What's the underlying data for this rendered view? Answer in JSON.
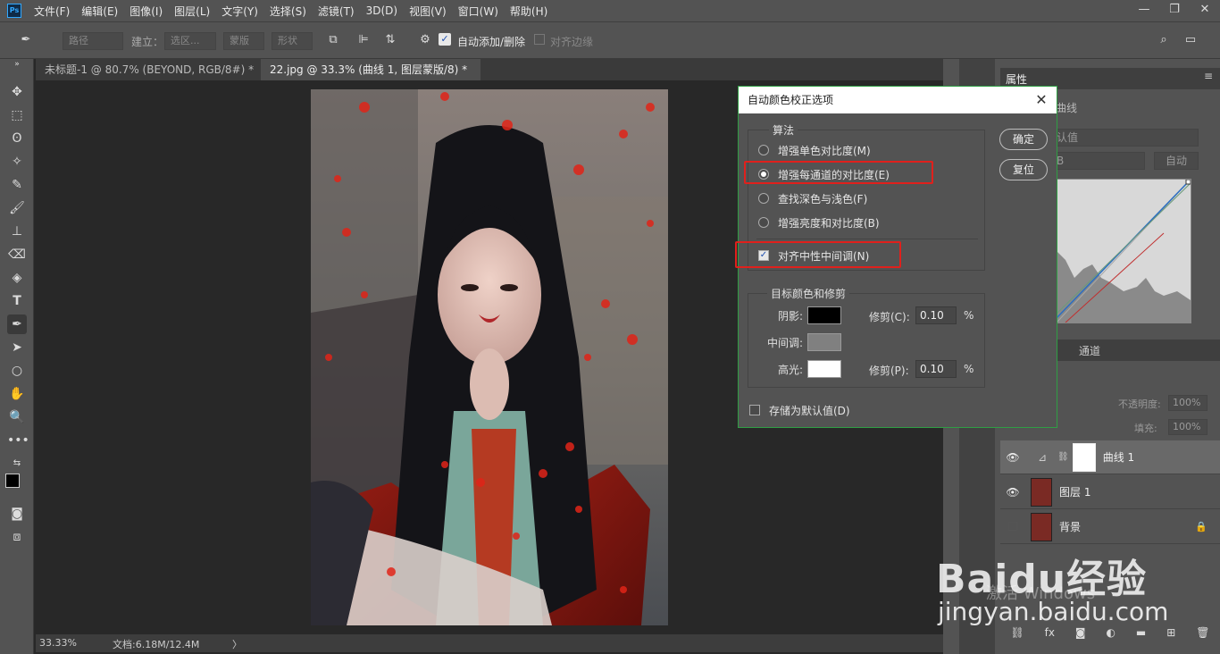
{
  "app": {
    "logo": "Ps"
  },
  "menu": [
    "文件(F)",
    "编辑(E)",
    "图像(I)",
    "图层(L)",
    "文字(Y)",
    "选择(S)",
    "滤镜(T)",
    "3D(D)",
    "视图(V)",
    "窗口(W)",
    "帮助(H)"
  ],
  "window_controls": {
    "minimize": "—",
    "restore": "❐",
    "close": "✕"
  },
  "options_bar": {
    "mode_select": "路径",
    "make_label": "建立：",
    "selection_btn": "选区...",
    "mask_btn": "蒙版",
    "shape_btn": "形状",
    "auto_add_delete": "自动添加/删除",
    "align_edges": "对齐边缘"
  },
  "tabs": [
    {
      "label": "未标题-1 @ 80.7% (BEYOND, RGB/8#) *",
      "close": "✕"
    },
    {
      "label": "22.jpg @ 33.3% (曲线 1, 图层蒙版/8) *",
      "close": "✕"
    }
  ],
  "status": {
    "zoom": "33.33%",
    "doc": "文档:6.18M/12.4M",
    "arrow": "〉"
  },
  "dialog": {
    "title": "自动颜色校正选项",
    "close": "✕",
    "algo_group": "算法",
    "options": [
      {
        "label": "增强单色对比度(M)",
        "selected": false
      },
      {
        "label": "增强每通道的对比度(E)",
        "selected": true
      },
      {
        "label": "查找深色与浅色(F)",
        "selected": false
      },
      {
        "label": "增强亮度和对比度(B)",
        "selected": false
      }
    ],
    "snap_neutral": {
      "label": "对齐中性中间调(N)",
      "checked": true
    },
    "target_group": "目标颜色和修剪",
    "shadows_label": "阴影:",
    "midtones_label": "中间调:",
    "highlights_label": "高光:",
    "shadows_color": "#000000",
    "midtones_color": "#808080",
    "highlights_color": "#ffffff",
    "clip_shadows_label": "修剪(C):",
    "clip_shadows_value": "0.10",
    "clip_highlights_label": "修剪(P):",
    "clip_highlights_value": "0.10",
    "percent": "%",
    "save_default": {
      "label": "存储为默认值(D)",
      "checked": false
    },
    "ok_label": "确定",
    "reset_label": "复位"
  },
  "properties": {
    "tab": "属性",
    "curve_label": "曲线",
    "preset": "认值",
    "channel": "B",
    "auto_btn": "自动"
  },
  "layers_panel": {
    "channels_tab": "通道",
    "opacity_label": "不透明度:",
    "opacity_value": "100%",
    "fill_label": "填充:",
    "fill_value": "100%",
    "layers": [
      {
        "name": "曲线 1",
        "visible": true,
        "selected": true
      },
      {
        "name": "图层 1",
        "visible": true,
        "selected": false
      },
      {
        "name": "背景",
        "visible": false,
        "selected": false
      }
    ]
  },
  "watermark": {
    "brand": "Baidu经验",
    "url": "jingyan.baidu.com",
    "activate": "激活 Windows"
  }
}
